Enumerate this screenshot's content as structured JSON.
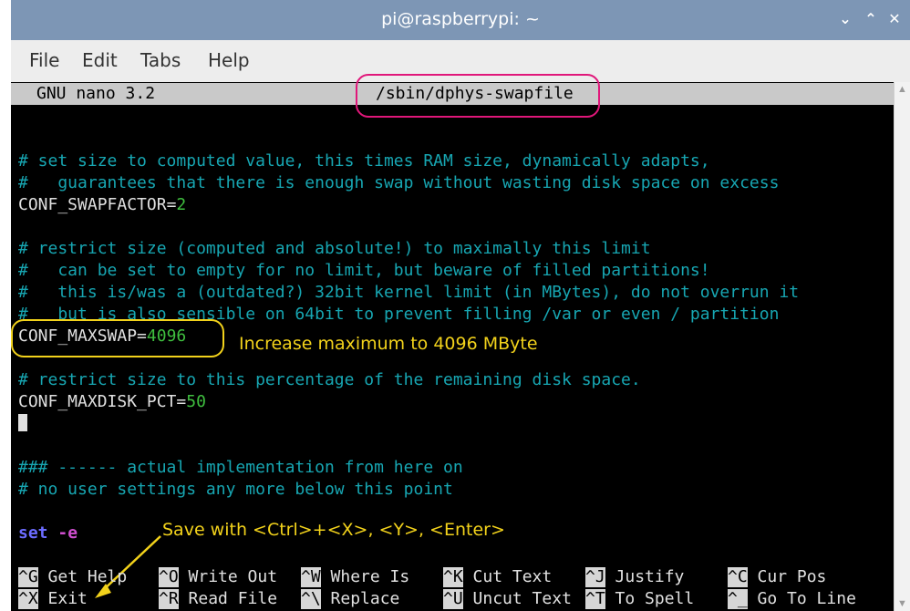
{
  "window": {
    "title": "pi@raspberrypi: ~"
  },
  "window_controls": {
    "minimize": "⌄",
    "maximize": "⌃",
    "close": "✕"
  },
  "menu": [
    "File",
    "Edit",
    "Tabs",
    "Help"
  ],
  "nano": {
    "app_version": "GNU nano 3.2",
    "filename": "/sbin/dphys-swapfile"
  },
  "lines": {
    "l1": "# set size to computed value, this times RAM size, dynamically adapts,",
    "l2": "#   guarantees that there is enough swap without wasting disk space on excess",
    "l3_key": "CONF_SWAPFACTOR",
    "l3_val": "2",
    "l4": "# restrict size (computed and absolute!) to maximally this limit",
    "l5": "#   can be set to empty for no limit, but beware of filled partitions!",
    "l6": "#   this is/was a (outdated?) 32bit kernel limit (in MBytes), do not overrun it",
    "l7": "#   but is also sensible on 64bit to prevent filling /var or even / partition",
    "l8_key": "CONF_MAXSWAP",
    "l8_val": "4096",
    "l9": "# restrict size to this percentage of the remaining disk space.",
    "l10_key": "CONF_MAXDISK_PCT",
    "l10_val": "50",
    "l11": "### ------ actual implementation from here on",
    "l12": "# no user settings any more below this point",
    "l13_kw": "set",
    "l13_flag": "-e",
    "equals": "="
  },
  "shortcuts": [
    {
      "key": "^G",
      "label": "Get Help"
    },
    {
      "key": "^O",
      "label": "Write Out"
    },
    {
      "key": "^W",
      "label": "Where Is"
    },
    {
      "key": "^K",
      "label": "Cut Text"
    },
    {
      "key": "^J",
      "label": "Justify"
    },
    {
      "key": "^C",
      "label": "Cur Pos"
    },
    {
      "key": "^X",
      "label": "Exit"
    },
    {
      "key": "^R",
      "label": "Read File"
    },
    {
      "key": "^\\",
      "label": "Replace"
    },
    {
      "key": "^U",
      "label": "Uncut Text"
    },
    {
      "key": "^T",
      "label": "To Spell"
    },
    {
      "key": "^_",
      "label": "Go To Line"
    }
  ],
  "annotations": {
    "increase": "Increase maximum to 4096 MByte",
    "save": "Save with <Ctrl>+<X>, <Y>, <Enter>"
  },
  "colors": {
    "titlebar": "#7d96b5",
    "comment": "#17a6b2",
    "value": "#3fbf3f",
    "annotation": "#f2d21b",
    "filename_highlight": "#e0177a",
    "arrow": "#f2d21b"
  },
  "icons": {
    "scroll_up": "triangle-up",
    "scroll_down": "triangle-down"
  }
}
